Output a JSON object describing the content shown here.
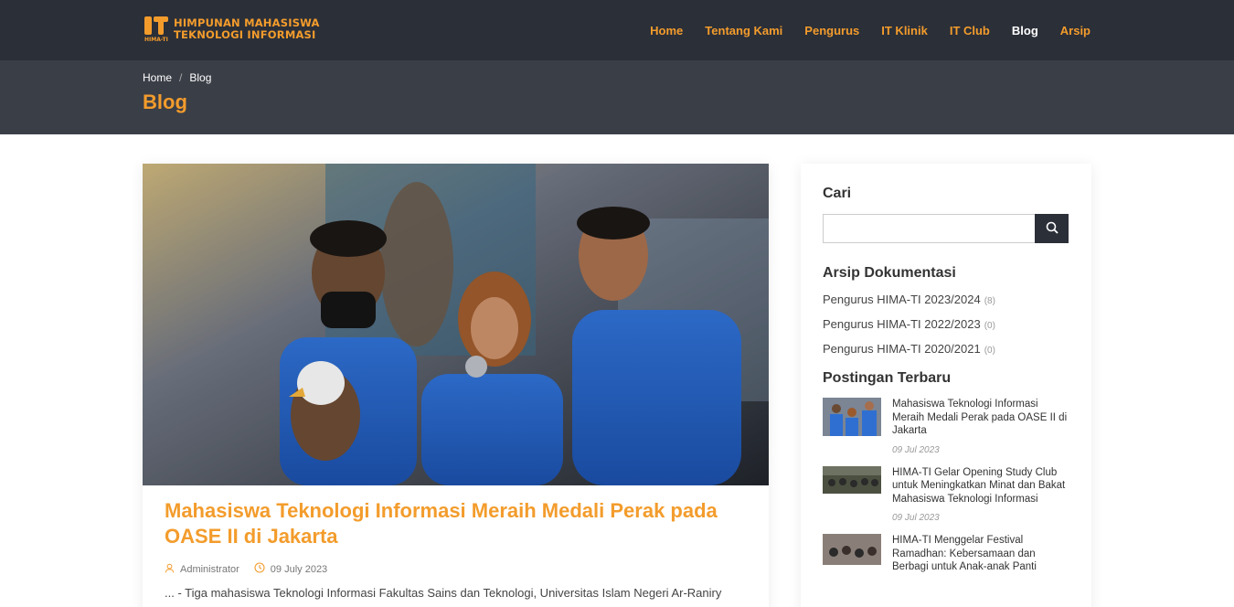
{
  "brand": {
    "line1": "HIMPUNAN MAHASISWA",
    "line2": "TEKNOLOGI INFORMASI",
    "short": "HIMA-TI",
    "accent": "#f39c2c",
    "header_bg": "#2b2f38"
  },
  "nav": {
    "items": [
      {
        "label": "Home",
        "active": false
      },
      {
        "label": "Tentang Kami",
        "active": false
      },
      {
        "label": "Pengurus",
        "active": false
      },
      {
        "label": "IT Klinik",
        "active": false
      },
      {
        "label": "IT Club",
        "active": false
      },
      {
        "label": "Blog",
        "active": true
      },
      {
        "label": "Arsip",
        "active": false
      }
    ]
  },
  "breadcrumb": {
    "items": [
      "Home",
      "Blog"
    ],
    "separator": "/"
  },
  "page": {
    "title": "Blog"
  },
  "post": {
    "image_icon": "photo-icon",
    "title": "Mahasiswa Teknologi Informasi Meraih Medali Perak pada OASE II di Jakarta",
    "author": "Administrator",
    "date": "09 July 2023",
    "excerpt": "... - Tiga mahasiswa Teknologi Informasi Fakultas Sains dan Teknologi, Universitas Islam Negeri Ar-Raniry"
  },
  "sidebar": {
    "search": {
      "heading": "Cari",
      "value": "",
      "icon": "search-icon"
    },
    "archive": {
      "heading": "Arsip Dokumentasi",
      "items": [
        {
          "label": "Pengurus HIMA-TI 2023/2024",
          "count": "(8)"
        },
        {
          "label": "Pengurus HIMA-TI 2022/2023",
          "count": "(0)"
        },
        {
          "label": "Pengurus HIMA-TI 2020/2021",
          "count": "(0)"
        }
      ]
    },
    "recent": {
      "heading": "Postingan Terbaru",
      "items": [
        {
          "title": "Mahasiswa Teknologi Informasi Meraih Medali Perak pada OASE II di Jakarta",
          "date": "09 Jul 2023"
        },
        {
          "title": "HIMA-TI Gelar Opening Study Club untuk Meningkatkan Minat dan Bakat Mahasiswa Teknologi Informasi",
          "date": "09 Jul 2023"
        },
        {
          "title": "HIMA-TI Menggelar Festival Ramadhan: Kebersamaan dan Berbagi untuk Anak-anak Panti",
          "date": ""
        }
      ]
    }
  }
}
